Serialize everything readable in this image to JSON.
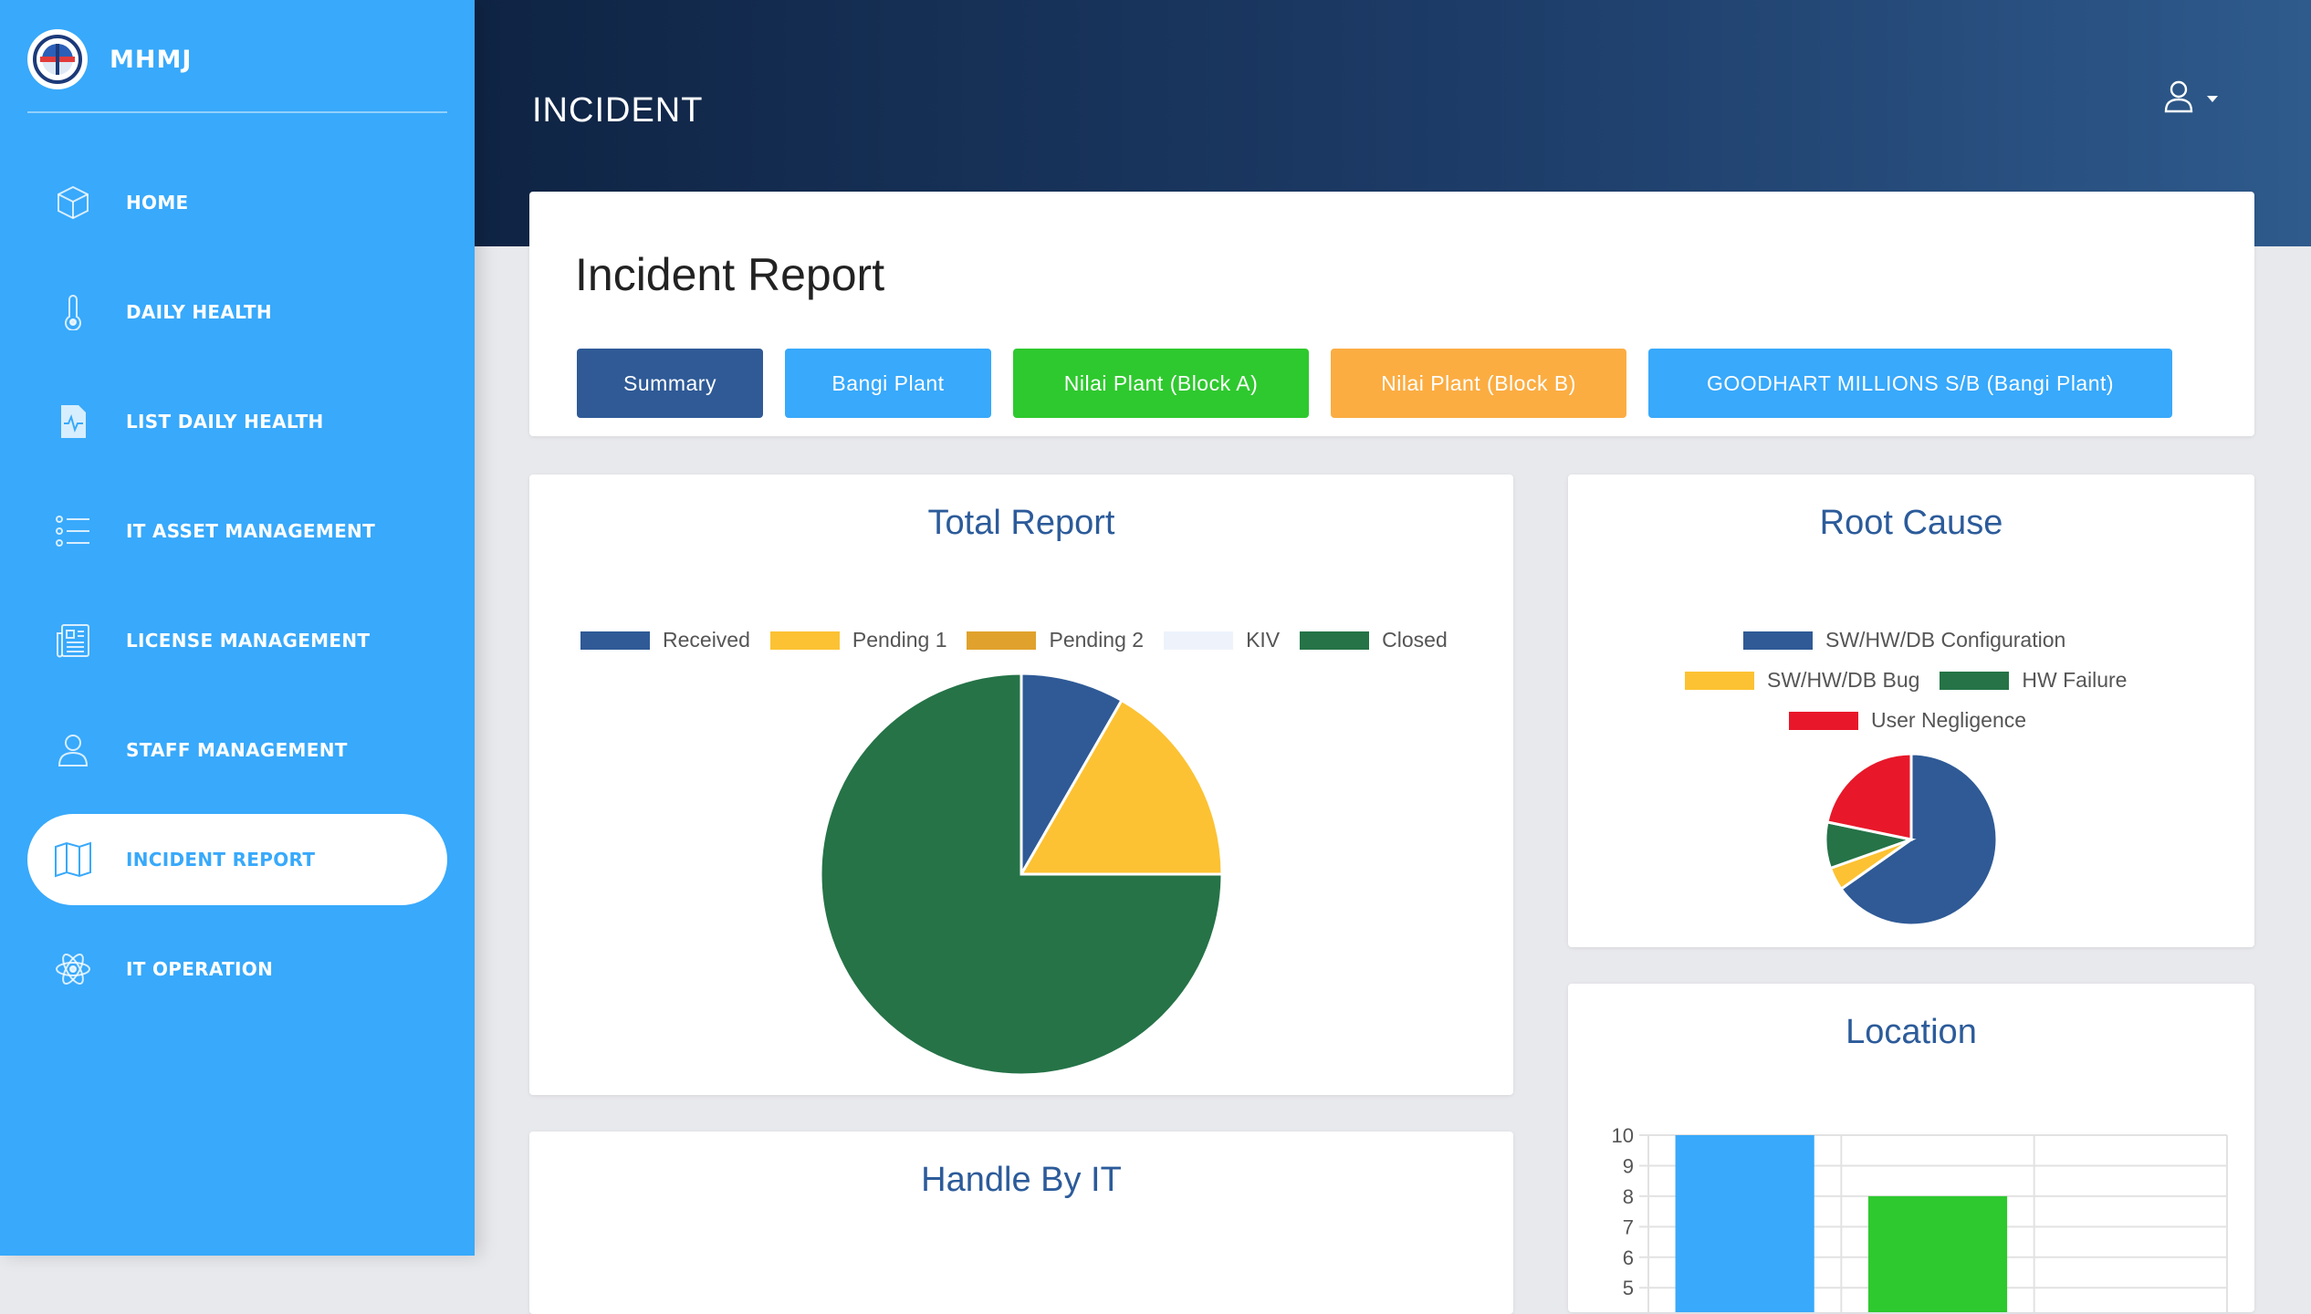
{
  "app": {
    "name": "MHMJ"
  },
  "page": {
    "heading": "INCIDENT"
  },
  "sidebar": {
    "items": [
      {
        "label": "HOME",
        "icon": "cube-icon"
      },
      {
        "label": "DAILY HEALTH",
        "icon": "thermometer-icon"
      },
      {
        "label": "LIST DAILY HEALTH",
        "icon": "medical-file-icon"
      },
      {
        "label": "IT ASSET MANAGEMENT",
        "icon": "list-icon"
      },
      {
        "label": "LICENSE MANAGEMENT",
        "icon": "newspaper-icon"
      },
      {
        "label": "STAFF MANAGEMENT",
        "icon": "user-icon"
      },
      {
        "label": "INCIDENT REPORT",
        "icon": "map-icon",
        "active": true
      },
      {
        "label": "IT OPERATION",
        "icon": "atom-icon"
      }
    ]
  },
  "report": {
    "title": "Incident Report",
    "tabs": [
      {
        "label": "Summary",
        "color": "#2f5a96"
      },
      {
        "label": "Bangi Plant",
        "color": "#38a9fb"
      },
      {
        "label": "Nilai Plant (Block A)",
        "color": "#2ec92e"
      },
      {
        "label": "Nilai Plant (Block B)",
        "color": "#fbad42"
      },
      {
        "label": "GOODHART MILLIONS S/B (Bangi Plant)",
        "color": "#38a9fb"
      }
    ]
  },
  "cards": {
    "total_report": {
      "title": "Total Report"
    },
    "root_cause": {
      "title": "Root Cause"
    },
    "location": {
      "title": "Location"
    },
    "handle_by_it": {
      "title": "Handle By IT"
    }
  },
  "colors": {
    "sidebar": "#38a9fb",
    "accent": "#2c5b9a",
    "received": "#2f5a96",
    "pending1": "#fcc233",
    "pending2": "#e0a22c",
    "kiv": "#eef3fb",
    "closed": "#257347",
    "user_negligence": "#e8182a"
  },
  "chart_data": [
    {
      "type": "pie",
      "title": "Total Report",
      "labels": [
        "Received",
        "Pending 1",
        "Pending 2",
        "KIV",
        "Closed"
      ],
      "values": [
        2,
        4,
        0,
        0,
        18
      ],
      "colors": [
        "#2f5a96",
        "#fcc233",
        "#e0a22c",
        "#eef3fb",
        "#257347"
      ],
      "legend": "top"
    },
    {
      "type": "pie",
      "title": "Root Cause",
      "labels": [
        "SW/HW/DB Configuration",
        "SW/HW/DB Bug",
        "HW Failure",
        "User Negligence"
      ],
      "values": [
        15,
        1,
        2,
        5
      ],
      "colors": [
        "#2f5a96",
        "#fcc233",
        "#257347",
        "#e8182a"
      ],
      "legend": "top"
    },
    {
      "type": "bar",
      "title": "Location",
      "categories": [
        "",
        "",
        ""
      ],
      "values": [
        10,
        8,
        0
      ],
      "colors": [
        "#38a9fb",
        "#2ec92e",
        "#fbad42"
      ],
      "yticks": [
        "10",
        "9",
        "8",
        "7",
        "6",
        "5"
      ],
      "grid": true
    }
  ]
}
